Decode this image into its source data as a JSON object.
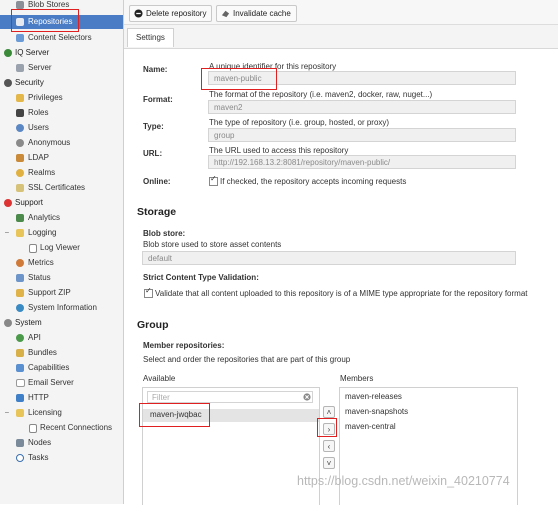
{
  "sidebar": {
    "items": [
      {
        "label": "Blob Stores",
        "icon": "blob-store-icon"
      },
      {
        "label": "Repositories",
        "icon": "repositories-icon",
        "selected": true
      },
      {
        "label": "Content Selectors",
        "icon": "content-selectors-icon"
      },
      {
        "label": "IQ Server",
        "icon": "iq-server-icon",
        "section": true
      },
      {
        "label": "Server",
        "icon": "server-icon"
      },
      {
        "label": "Security",
        "icon": "security-icon",
        "section": true
      },
      {
        "label": "Privileges",
        "icon": "privileges-icon"
      },
      {
        "label": "Roles",
        "icon": "roles-icon"
      },
      {
        "label": "Users",
        "icon": "users-icon"
      },
      {
        "label": "Anonymous",
        "icon": "anonymous-icon"
      },
      {
        "label": "LDAP",
        "icon": "ldap-icon"
      },
      {
        "label": "Realms",
        "icon": "realms-icon"
      },
      {
        "label": "SSL Certificates",
        "icon": "ssl-certificates-icon"
      },
      {
        "label": "Support",
        "icon": "support-icon",
        "section": true
      },
      {
        "label": "Analytics",
        "icon": "analytics-icon"
      },
      {
        "label": "Logging",
        "icon": "logging-icon",
        "expandable": true
      },
      {
        "label": "Log Viewer",
        "icon": "log-viewer-icon"
      },
      {
        "label": "Metrics",
        "icon": "metrics-icon"
      },
      {
        "label": "Status",
        "icon": "status-icon"
      },
      {
        "label": "Support ZIP",
        "icon": "support-zip-icon"
      },
      {
        "label": "System Information",
        "icon": "system-information-icon"
      },
      {
        "label": "System",
        "icon": "system-icon",
        "section": true
      },
      {
        "label": "API",
        "icon": "api-icon"
      },
      {
        "label": "Bundles",
        "icon": "bundles-icon"
      },
      {
        "label": "Capabilities",
        "icon": "capabilities-icon"
      },
      {
        "label": "Email Server",
        "icon": "email-server-icon"
      },
      {
        "label": "HTTP",
        "icon": "http-icon"
      },
      {
        "label": "Licensing",
        "icon": "licensing-icon",
        "expandable": true
      },
      {
        "label": "Recent Connections",
        "icon": "recent-connections-icon"
      },
      {
        "label": "Nodes",
        "icon": "nodes-icon"
      },
      {
        "label": "Tasks",
        "icon": "tasks-icon"
      }
    ]
  },
  "toolbar": {
    "delete_label": "Delete repository",
    "invalidate_label": "Invalidate cache"
  },
  "tabs": {
    "settings": "Settings"
  },
  "form": {
    "name": {
      "label": "Name:",
      "desc": "A unique identifier for this repository",
      "value": "maven-public"
    },
    "format": {
      "label": "Format:",
      "desc": "The format of the repository (i.e. maven2, docker, raw, nuget...)",
      "value": "maven2"
    },
    "type": {
      "label": "Type:",
      "desc": "The type of repository (i.e. group, hosted, or proxy)",
      "value": "group"
    },
    "url": {
      "label": "URL:",
      "desc": "The URL used to access this repository",
      "value": "http://192.168.13.2:8081/repository/maven-public/"
    },
    "online": {
      "label": "Online:",
      "desc": "If checked, the repository accepts incoming requests"
    }
  },
  "storage": {
    "heading": "Storage",
    "blob_label": "Blob store:",
    "blob_desc": "Blob store used to store asset contents",
    "blob_value": "default",
    "strict_label": "Strict Content Type Validation:",
    "strict_desc": "Validate that all content uploaded to this repository is of a MIME type appropriate for the repository format"
  },
  "group": {
    "heading": "Group",
    "members_label": "Member repositories:",
    "members_desc": "Select and order the repositories that are part of this group",
    "available_header": "Available",
    "members_header": "Members",
    "filter_placeholder": "Filter",
    "available": [
      "maven-jwqbac"
    ],
    "members": [
      "maven-releases",
      "maven-snapshots",
      "maven-central"
    ]
  },
  "move_buttons": {
    "top": "˄",
    "right": "›",
    "left": "‹",
    "bottom": "˅"
  },
  "watermark": "https://blog.csdn.net/weixin_40210774",
  "colors": {
    "selected": "#4a7cc5",
    "highlight": "#e02020"
  }
}
